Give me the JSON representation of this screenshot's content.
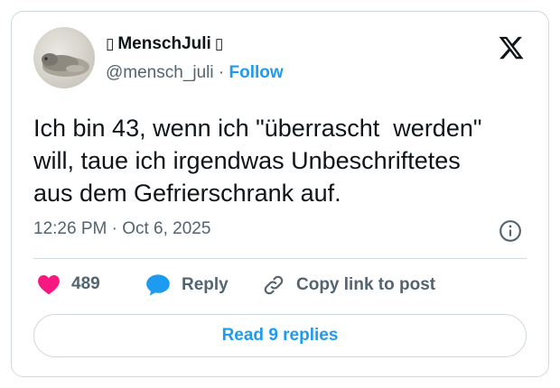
{
  "tweet": {
    "author": {
      "display_name": "MenschJuli",
      "name_prefix_glyph": "▯",
      "name_suffix_glyph": "▯",
      "handle": "@mensch_juli",
      "separator": "·",
      "follow_label": "Follow"
    },
    "text": "Ich bin 43, wenn ich \"überrascht  werden\"\nwill, taue ich irgendwas Unbeschriftetes\naus dem Gefrierschrank auf.",
    "timestamp": "12:26 PM · Oct 6, 2025",
    "actions": {
      "likes": "489",
      "reply_label": "Reply",
      "copy_label": "Copy link to post"
    },
    "read_replies_label": "Read 9 replies"
  },
  "icons": {
    "brand": "x-logo-icon",
    "info": "info-icon",
    "like": "heart-icon",
    "reply": "speech-bubble-icon",
    "copy": "link-icon"
  },
  "colors": {
    "accent": "#1d9bf0",
    "like": "#f91880",
    "text": "#0f1419",
    "secondary": "#536471",
    "border": "#cfd9de"
  }
}
